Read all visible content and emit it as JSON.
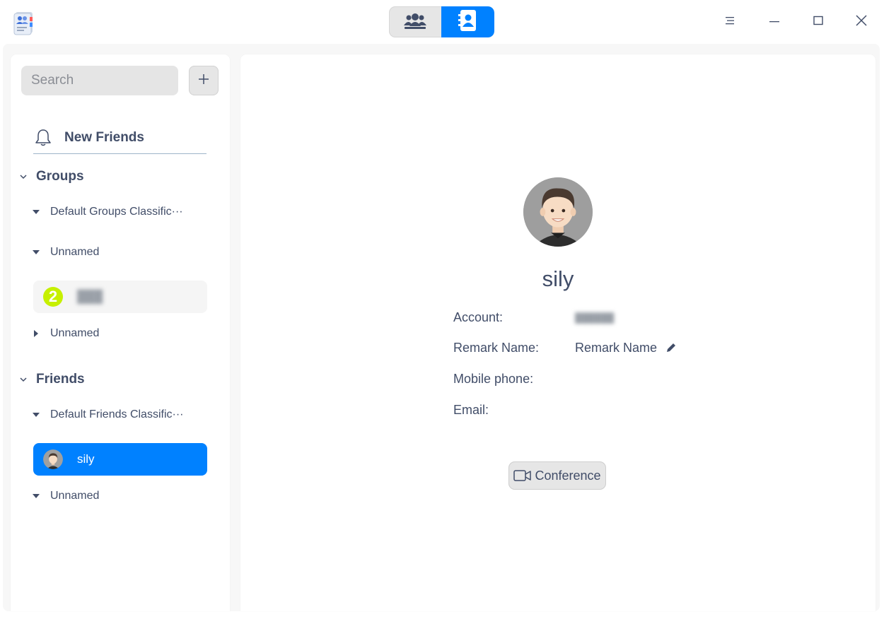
{
  "titlebar": {
    "app_icon": "address-book-icon",
    "view_tabs": [
      {
        "icon": "group-people-icon",
        "active": false
      },
      {
        "icon": "contact-card-icon",
        "active": true
      }
    ],
    "window_controls": [
      "menu-icon",
      "minimize-icon",
      "maximize-icon",
      "close-icon"
    ]
  },
  "sidebar": {
    "search": {
      "placeholder": "Search",
      "value": ""
    },
    "add_icon": "plus-icon",
    "new_friends": {
      "label": "New Friends",
      "icon": "bell-icon"
    },
    "groups": {
      "label": "Groups",
      "subgroups": [
        {
          "label": "Default Groups Classific···",
          "expanded": true
        },
        {
          "label": "Unnamed",
          "expanded": true
        },
        {
          "label": "Unnamed",
          "expanded": false
        }
      ],
      "member": {
        "name": "███",
        "avatar_badge": "2"
      }
    },
    "friends": {
      "label": "Friends",
      "subgroups": [
        {
          "label": "Default Friends Classific···",
          "expanded": true
        },
        {
          "label": "Unnamed",
          "expanded": true
        }
      ],
      "selected_contact": {
        "name": "sily"
      }
    }
  },
  "detail": {
    "name": "sily",
    "fields": [
      {
        "key": "Account:",
        "value": "██████"
      },
      {
        "key": "Remark Name:",
        "value": "Remark Name"
      },
      {
        "key": "Mobile phone:",
        "value": ""
      },
      {
        "key": "Email:",
        "value": ""
      }
    ],
    "conference_button": {
      "label": "Conference",
      "icon": "video-camera-icon"
    }
  },
  "colors": {
    "accent": "#0081ff",
    "text": "#414d68",
    "badge": "#c6f000"
  }
}
